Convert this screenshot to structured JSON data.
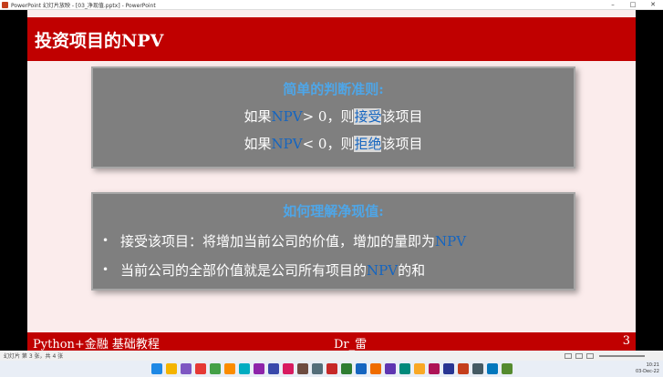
{
  "window": {
    "title": "PowerPoint 幻灯片放映 - [03_净现值.pptx] - PowerPoint"
  },
  "slide": {
    "title": "投资项目的NPV",
    "box1": {
      "heading": "简单的判断准则:",
      "line1": {
        "prefix": "如果",
        "npv": "NPV",
        "op": "> 0，则",
        "action": "接受",
        "suffix": "该项目"
      },
      "line2": {
        "prefix": "如果",
        "npv": "NPV",
        "op": "< 0，则",
        "action": "拒绝",
        "suffix": "该项目"
      }
    },
    "box2": {
      "heading": "如何理解净现值:",
      "bullets": [
        {
          "text": "接受该项目：将增加当前公司的价值，增加的量即为",
          "npv": "NPV",
          "tail": ""
        },
        {
          "text": "当前公司的全部价值就是公司所有项目的",
          "npv": "NPV",
          "tail": "的和"
        }
      ],
      "bullet_symbol": "•"
    },
    "footer": {
      "left": "Python+金融 基础教程",
      "center": "Dr_雷",
      "right": "3"
    }
  },
  "statusbar": {
    "slide_info": "幻灯片 第 3 张，共 4 张"
  },
  "taskbar": {
    "time": "10:21",
    "date": "03-Dec-22",
    "icon_colors": [
      "#1e88e5",
      "#f4b400",
      "#7e57c2",
      "#e53935",
      "#43a047",
      "#fb8c00",
      "#00acc1",
      "#8e24aa",
      "#3949ab",
      "#d81b60",
      "#6d4c41",
      "#546e7a",
      "#c62828",
      "#2e7d32",
      "#1565c0",
      "#ef6c00",
      "#5e35b1",
      "#00897b",
      "#f9a825",
      "#ad1457",
      "#283593",
      "#c43e1c",
      "#455a64",
      "#0277bd",
      "#558b2f"
    ]
  }
}
